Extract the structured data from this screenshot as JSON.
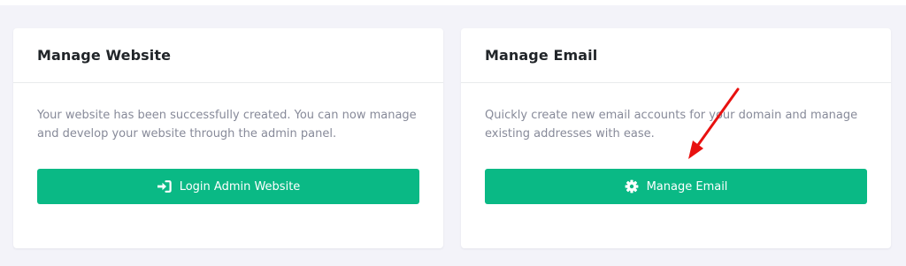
{
  "cards": {
    "website": {
      "title": "Manage Website",
      "description": "Your website has been successfully created. You can now manage and develop your website through the admin panel.",
      "button_label": "Login Admin Website",
      "button_icon": "sign-in-icon"
    },
    "email": {
      "title": "Manage Email",
      "description": "Quickly create new email accounts for your domain and manage existing addresses with ease.",
      "button_label": "Manage Email",
      "button_icon": "gear-icon"
    }
  },
  "colors": {
    "page_background": "#f3f3f9",
    "card_background": "#ffffff",
    "button_primary": "#0ab985",
    "title_text": "#212529",
    "body_text": "#878a99",
    "annotation_arrow": "#e8110f"
  }
}
